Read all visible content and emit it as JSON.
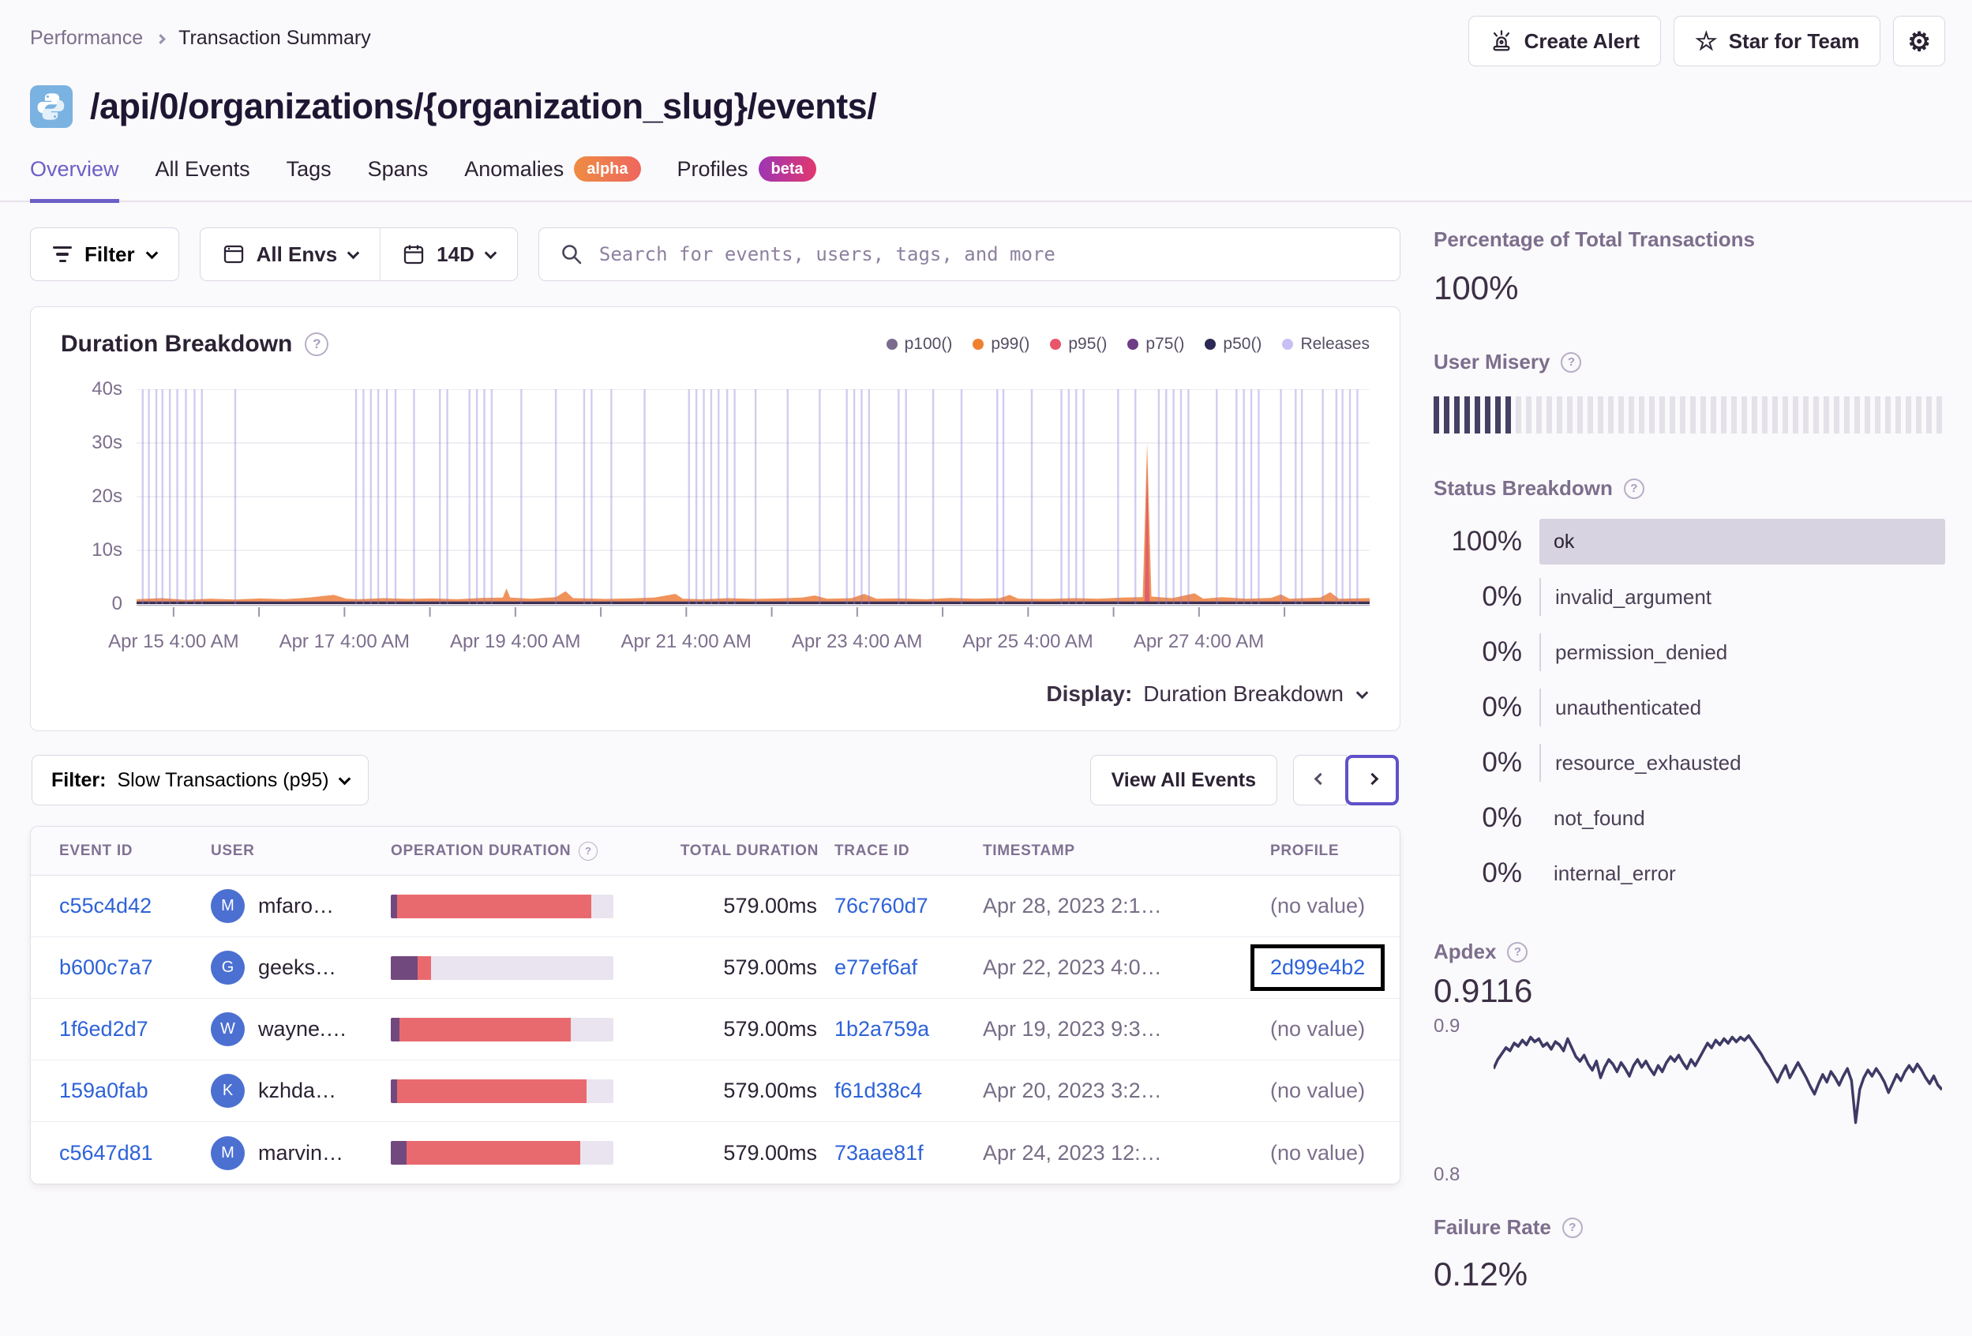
{
  "icons": {
    "help": "?",
    "star": "☆",
    "gear": "⚙"
  },
  "breadcrumb": {
    "parent": "Performance",
    "current": "Transaction Summary"
  },
  "actions": {
    "create_alert": "Create Alert",
    "star_for_team": "Star for Team"
  },
  "title": "/api/0/organizations/{organization_slug}/events/",
  "tabs": [
    {
      "label": "Overview",
      "active": true
    },
    {
      "label": "All Events"
    },
    {
      "label": "Tags"
    },
    {
      "label": "Spans"
    },
    {
      "label": "Anomalies",
      "badge": "alpha",
      "badge_type": "alpha"
    },
    {
      "label": "Profiles",
      "badge": "beta",
      "badge_type": "beta"
    }
  ],
  "filters": {
    "filter_label": "Filter",
    "env_label": "All Envs",
    "date_label": "14D",
    "search_placeholder": "Search for events, users, tags, and more"
  },
  "duration_chart": {
    "title": "Duration Breakdown",
    "legend": [
      {
        "label": "p100()",
        "color": "#7a6c8e"
      },
      {
        "label": "p99()",
        "color": "#ef8030"
      },
      {
        "label": "p95()",
        "color": "#e9566b"
      },
      {
        "label": "p75()",
        "color": "#6f3d85"
      },
      {
        "label": "p50()",
        "color": "#2c2a54"
      },
      {
        "label": "Releases",
        "color": "#c9bff5"
      }
    ],
    "y_ticks": [
      {
        "label": "40s",
        "v": 40
      },
      {
        "label": "30s",
        "v": 30
      },
      {
        "label": "20s",
        "v": 20
      },
      {
        "label": "10s",
        "v": 10
      },
      {
        "label": "0",
        "v": 0
      }
    ],
    "x_ticks": [
      "Apr 15 4:00 AM",
      "Apr 17 4:00 AM",
      "Apr 19 4:00 AM",
      "Apr 21 4:00 AM",
      "Apr 23 4:00 AM",
      "Apr 25 4:00 AM",
      "Apr 27 4:00 AM"
    ],
    "ymax": 40,
    "releases": [
      0.5,
      1.0,
      1.6,
      2.1,
      2.7,
      3.3,
      4.0,
      4.7,
      5.3,
      8.0,
      17.8,
      18.4,
      19.0,
      19.6,
      20.3,
      21.0,
      22.5,
      24.6,
      25.2,
      27.0,
      27.6,
      28.2,
      28.8,
      31.2,
      34.0,
      36.3,
      36.9,
      38.5,
      41.2,
      44.8,
      45.4,
      46.0,
      46.6,
      47.2,
      47.9,
      48.5,
      50.2,
      52.8,
      55.4,
      57.6,
      58.2,
      58.8,
      59.4,
      61.8,
      62.4,
      64.6,
      66.9,
      69.8,
      70.3,
      72.6,
      75.0,
      75.6,
      76.2,
      76.8,
      79.6,
      81.0,
      82.9,
      83.5,
      84.1,
      84.7,
      85.3,
      87.6,
      89.2,
      89.8,
      90.4,
      91.0,
      92.8,
      94.0,
      94.5,
      96.2,
      97.3,
      97.8,
      98.4,
      99.0
    ],
    "p99": [
      [
        0,
        0.9
      ],
      [
        2,
        1.1
      ],
      [
        4,
        0.8
      ],
      [
        6,
        1.0
      ],
      [
        8,
        0.85
      ],
      [
        10,
        1.05
      ],
      [
        12,
        0.9
      ],
      [
        14,
        1.2
      ],
      [
        16,
        1.7
      ],
      [
        17,
        1.0
      ],
      [
        18,
        0.9
      ],
      [
        20,
        1.1
      ],
      [
        22,
        0.95
      ],
      [
        24,
        1.05
      ],
      [
        26,
        0.9
      ],
      [
        28,
        1.15
      ],
      [
        29.7,
        1.2
      ],
      [
        30,
        2.9
      ],
      [
        30.3,
        1.2
      ],
      [
        32,
        1.0
      ],
      [
        34,
        1.3
      ],
      [
        34.8,
        2.4
      ],
      [
        35.4,
        1.1
      ],
      [
        38,
        0.95
      ],
      [
        40,
        1.05
      ],
      [
        42,
        1.2
      ],
      [
        43.7,
        1.9
      ],
      [
        44.3,
        1.0
      ],
      [
        46,
        0.9
      ],
      [
        48,
        1.1
      ],
      [
        50,
        0.95
      ],
      [
        52,
        1.05
      ],
      [
        54,
        1.2
      ],
      [
        55,
        1.6
      ],
      [
        56,
        1.0
      ],
      [
        58,
        1.1
      ],
      [
        59,
        1.9
      ],
      [
        60,
        1.0
      ],
      [
        62,
        1.05
      ],
      [
        64,
        0.9
      ],
      [
        66,
        1.15
      ],
      [
        68,
        1.0
      ],
      [
        70,
        1.1
      ],
      [
        70.8,
        1.7
      ],
      [
        71.5,
        1.0
      ],
      [
        74,
        0.95
      ],
      [
        76,
        1.1
      ],
      [
        78,
        1.0
      ],
      [
        80,
        1.2
      ],
      [
        81.6,
        1.3
      ],
      [
        81.95,
        30
      ],
      [
        82.3,
        1.4
      ],
      [
        84,
        1.1
      ],
      [
        85.8,
        2.0
      ],
      [
        86.5,
        1.0
      ],
      [
        88,
        1.3
      ],
      [
        90,
        1.0
      ],
      [
        92,
        1.15
      ],
      [
        92.8,
        1.8
      ],
      [
        93.5,
        1.0
      ],
      [
        96,
        1.2
      ],
      [
        96.8,
        2.2
      ],
      [
        97.5,
        1.0
      ],
      [
        100,
        1.1
      ]
    ],
    "p95_spike": [
      [
        81.75,
        0.4
      ],
      [
        81.95,
        26
      ],
      [
        82.15,
        0.4
      ]
    ],
    "display_label": "Display:",
    "display_value": "Duration Breakdown"
  },
  "table_controls": {
    "filter_label": "Filter:",
    "filter_value": "Slow Transactions (p95)",
    "view_all": "View All Events"
  },
  "events_table": {
    "columns": [
      "EVENT ID",
      "USER",
      "OPERATION DURATION",
      "TOTAL DURATION",
      "TRACE ID",
      "TIMESTAMP",
      "PROFILE"
    ],
    "rows": [
      {
        "event_id": "c55c4d42",
        "user_initial": "M",
        "user": "mfaro…",
        "bar": [
          3,
          87,
          10
        ],
        "total": "579.00ms",
        "trace": "76c760d7",
        "timestamp": "Apr 28, 2023 2:1…",
        "profile": "(no value)",
        "profile_link": false,
        "highlight": false
      },
      {
        "event_id": "b600c7a7",
        "user_initial": "G",
        "user": "geeks…",
        "bar": [
          12,
          6,
          82
        ],
        "total": "579.00ms",
        "trace": "e77ef6af",
        "timestamp": "Apr 22, 2023 4:0…",
        "profile": "2d99e4b2",
        "profile_link": true,
        "highlight": true
      },
      {
        "event_id": "1f6ed2d7",
        "user_initial": "W",
        "user": "wayne.…",
        "bar": [
          4,
          77,
          19
        ],
        "total": "579.00ms",
        "trace": "1b2a759a",
        "timestamp": "Apr 19, 2023 9:3…",
        "profile": "(no value)",
        "profile_link": false,
        "highlight": false
      },
      {
        "event_id": "159a0fab",
        "user_initial": "K",
        "user": "kzhda…",
        "bar": [
          3,
          85,
          12
        ],
        "total": "579.00ms",
        "trace": "f61d38c4",
        "timestamp": "Apr 20, 2023 3:2…",
        "profile": "(no value)",
        "profile_link": false,
        "highlight": false
      },
      {
        "event_id": "c5647d81",
        "user_initial": "M",
        "user": "marvin…",
        "bar": [
          7,
          78,
          15
        ],
        "total": "579.00ms",
        "trace": "73aae81f",
        "timestamp": "Apr 24, 2023 12:…",
        "profile": "(no value)",
        "profile_link": false,
        "highlight": false
      }
    ]
  },
  "sidebar": {
    "pct": {
      "label": "Percentage of Total Transactions",
      "value": "100%"
    },
    "misery": {
      "label": "User Misery",
      "total_ticks": 50,
      "dark_ticks": 8
    },
    "status": {
      "label": "Status Breakdown",
      "rows": [
        {
          "pct": "100%",
          "status": "ok",
          "full": true,
          "line": false
        },
        {
          "pct": "0%",
          "status": "invalid_argument",
          "full": false,
          "line": true
        },
        {
          "pct": "0%",
          "status": "permission_denied",
          "full": false,
          "line": true
        },
        {
          "pct": "0%",
          "status": "unauthenticated",
          "full": false,
          "line": true
        },
        {
          "pct": "0%",
          "status": "resource_exhausted",
          "full": false,
          "line": true
        },
        {
          "pct": "0%",
          "status": "not_found",
          "full": false,
          "line": false
        },
        {
          "pct": "0%",
          "status": "internal_error",
          "full": false,
          "line": false
        }
      ]
    },
    "apdex": {
      "label": "Apdex",
      "value": "0.9116",
      "y_top": "0.9",
      "y_bottom": "0.8",
      "points": [
        0.872,
        0.878,
        0.882,
        0.886,
        0.884,
        0.889,
        0.887,
        0.891,
        0.888,
        0.893,
        0.89,
        0.892,
        0.887,
        0.889,
        0.885,
        0.89,
        0.888,
        0.884,
        0.892,
        0.886,
        0.88,
        0.877,
        0.881,
        0.875,
        0.871,
        0.877,
        0.866,
        0.873,
        0.878,
        0.875,
        0.87,
        0.876,
        0.872,
        0.867,
        0.874,
        0.878,
        0.873,
        0.877,
        0.872,
        0.868,
        0.874,
        0.87,
        0.876,
        0.88,
        0.877,
        0.881,
        0.876,
        0.872,
        0.878,
        0.874,
        0.879,
        0.884,
        0.889,
        0.886,
        0.891,
        0.888,
        0.892,
        0.889,
        0.893,
        0.89,
        0.893,
        0.891,
        0.894,
        0.89,
        0.886,
        0.882,
        0.877,
        0.873,
        0.868,
        0.863,
        0.869,
        0.874,
        0.866,
        0.871,
        0.876,
        0.871,
        0.866,
        0.86,
        0.855,
        0.862,
        0.868,
        0.863,
        0.87,
        0.866,
        0.861,
        0.867,
        0.872,
        0.864,
        0.836,
        0.858,
        0.866,
        0.871,
        0.867,
        0.872,
        0.868,
        0.863,
        0.856,
        0.862,
        0.868,
        0.864,
        0.87,
        0.874,
        0.87,
        0.875,
        0.871,
        0.866,
        0.862,
        0.867,
        0.861,
        0.858
      ]
    },
    "failure": {
      "label": "Failure Rate",
      "value": "0.12%"
    }
  }
}
